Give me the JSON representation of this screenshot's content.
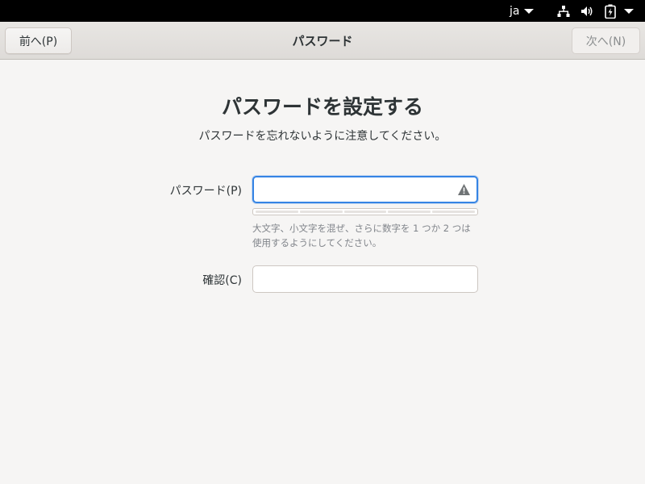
{
  "topbar": {
    "language": "ja",
    "icons": [
      "network-icon",
      "volume-icon",
      "battery-icon",
      "system-menu-caret-icon"
    ]
  },
  "header": {
    "back_label": "前へ(P)",
    "title": "パスワード",
    "next_label": "次へ(N)"
  },
  "main": {
    "heading": "パスワードを設定する",
    "subheading": "パスワードを忘れないように注意してください。",
    "password_label": "パスワード(P)",
    "password_value": "",
    "hint_line1": "大文字、小文字を混ぜ、さらに数字を 1 つか 2 つは",
    "hint_line2": "使用するようにしてください。",
    "confirm_label": "確認(C)",
    "confirm_value": "",
    "strength_level": 0
  },
  "colors": {
    "accent": "#3584e4",
    "topbar": "#000000",
    "background": "#f6f5f4"
  }
}
